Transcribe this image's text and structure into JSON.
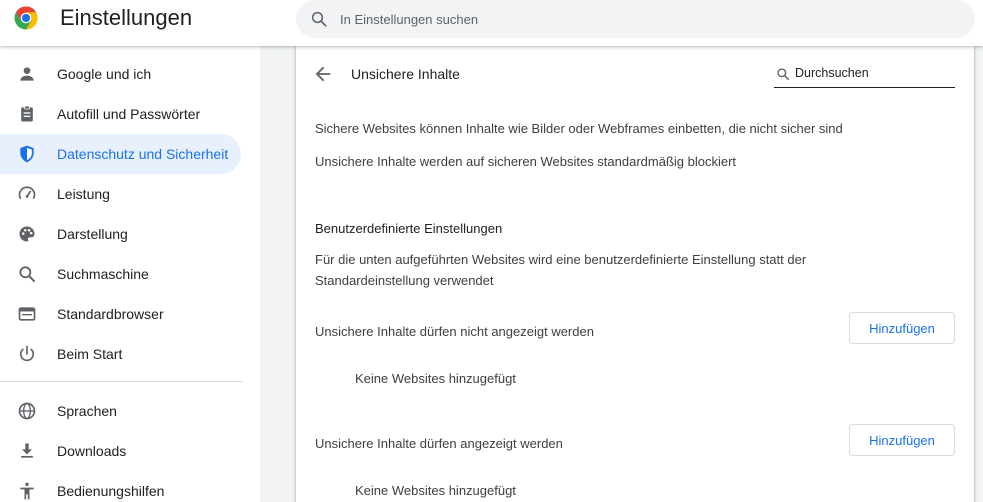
{
  "header": {
    "title": "Einstellungen",
    "search_placeholder": "In Einstellungen suchen"
  },
  "sidebar": {
    "items": [
      {
        "label": "Google und ich",
        "icon": "person-icon"
      },
      {
        "label": "Autofill und Passwörter",
        "icon": "clipboard-icon"
      },
      {
        "label": "Datenschutz und Sicherheit",
        "icon": "shield-icon",
        "active": true
      },
      {
        "label": "Leistung",
        "icon": "speedometer-icon"
      },
      {
        "label": "Darstellung",
        "icon": "palette-icon"
      },
      {
        "label": "Suchmaschine",
        "icon": "search-icon"
      },
      {
        "label": "Standardbrowser",
        "icon": "browser-window-icon"
      },
      {
        "label": "Beim Start",
        "icon": "power-icon"
      },
      {
        "label": "Sprachen",
        "icon": "globe-icon"
      },
      {
        "label": "Downloads",
        "icon": "download-icon"
      },
      {
        "label": "Bedienungshilfen",
        "icon": "accessibility-icon"
      }
    ]
  },
  "main": {
    "title": "Unsichere Inhalte",
    "search_placeholder": "Durchsuchen",
    "description": "Sichere Websites können Inhalte wie Bilder oder Webframes einbetten, die nicht sicher sind",
    "default_state": "Unsichere Inhalte werden auf sicheren Websites standardmäßig blockiert",
    "custom_heading": "Benutzerdefinierte Einstellungen",
    "custom_description_line1": "Für die unten aufgeführten Websites wird eine benutzerdefinierte Einstellung statt der",
    "custom_description_line2": "Standardeinstellung verwendet",
    "blocked": {
      "label": "Unsichere Inhalte dürfen nicht angezeigt werden",
      "add_button": "Hinzufügen",
      "empty": "Keine Websites hinzugefügt"
    },
    "allowed": {
      "label": "Unsichere Inhalte dürfen angezeigt werden",
      "add_button": "Hinzufügen",
      "empty": "Keine Websites hinzugefügt"
    }
  },
  "colors": {
    "accent": "#1a73e8",
    "active_bg": "#e8f0fe",
    "page_bg": "#f1f3f4"
  }
}
